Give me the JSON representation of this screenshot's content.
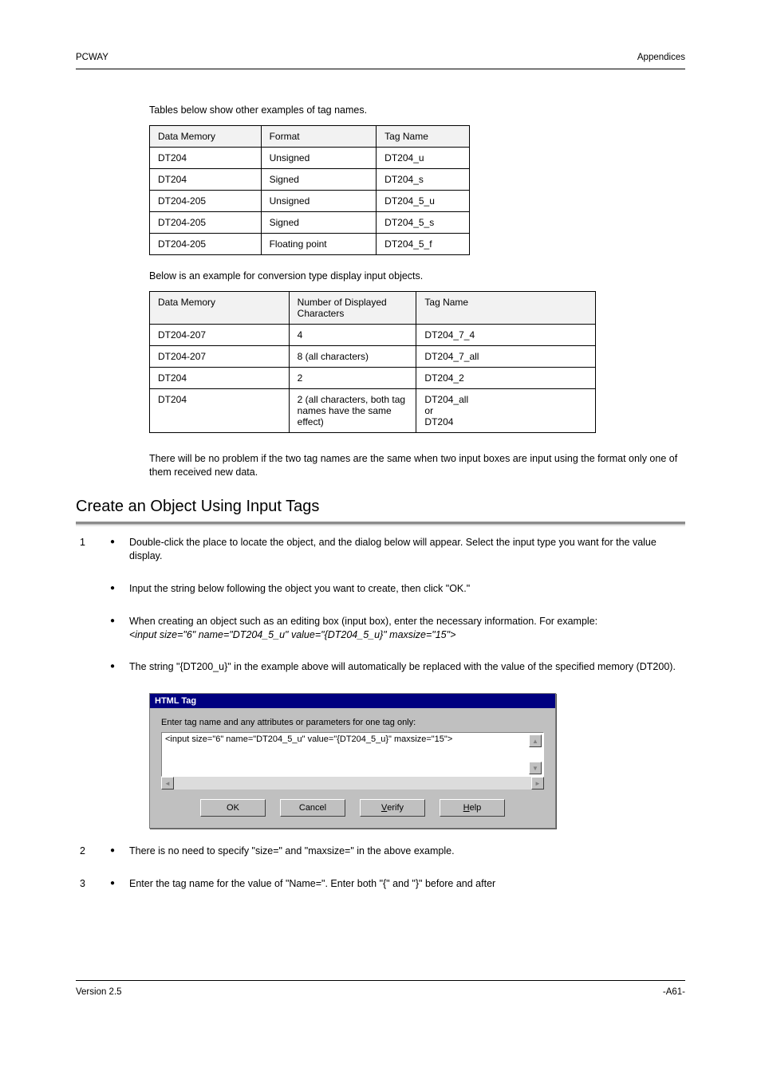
{
  "header": {
    "left": "PCWAY",
    "right": "Appendices"
  },
  "intro": "Tables below show other examples of tag names.",
  "table1": {
    "headers": [
      "Data Memory",
      "Format",
      "Tag Name"
    ],
    "rows": [
      [
        "DT204",
        "Unsigned",
        "DT204_u"
      ],
      [
        "DT204",
        "Signed",
        "DT204_s"
      ],
      [
        "DT204-205",
        "Unsigned",
        "DT204_5_u"
      ],
      [
        "DT204-205",
        "Signed",
        "DT204_5_s"
      ],
      [
        "DT204-205",
        "Floating point",
        "DT204_5_f"
      ]
    ]
  },
  "between": "Below is an example for conversion type display input objects.",
  "table2": {
    "headers": [
      "Data Memory",
      "Number of Displayed Characters",
      "Tag Name"
    ],
    "rows": [
      [
        "DT204-207",
        "4",
        "DT204_7_4"
      ],
      [
        "DT204-207",
        "8 (all characters)",
        "DT204_7_all"
      ],
      [
        "DT204",
        "2",
        "DT204_2"
      ],
      [
        "DT204",
        "2 (all characters, both tag names have the same effect)",
        "DT204_all\nor\nDT204"
      ]
    ]
  },
  "after": "There will be no problem if the two tag names are the same when two input boxes are input using the format only one of them received new data.",
  "heading": "Create an Object Using Input Tags",
  "steps": [
    {
      "num": "1",
      "text": "Double-click the place to locate the object, and the dialog below will appear. Select the input type you want for the value display."
    },
    {
      "num": "",
      "text": "Input the string below following the object you want to create, then click \"OK.\""
    },
    {
      "num": "",
      "text": "When creating an object such as an editing box (input box), enter the necessary information. For example:\n<input size=\"6\" name=\"DT204_5_u\" value=\"{DT204_5_u}\" maxsize=\"15\">"
    },
    {
      "num": "",
      "text": "The string \"{DT200_u}\" in the example above will automatically be replaced with the value of the specified memory (DT200)."
    },
    {
      "num": "2  •",
      "text": "There is no need to specify \"size=\" and \"maxsize=\" in the above example."
    },
    {
      "num": "3  •",
      "text": "Enter the tag name for the value of \"Name=\". Enter both \"{\" and \"}\" before and after"
    }
  ],
  "dialog": {
    "title": "HTML Tag",
    "label": "Enter tag name and any attributes or parameters for one tag only:",
    "value": "<input size=\"6\" name=\"DT204_5_u\" value=\"{DT204_5_u}\" maxsize=\"15\">",
    "buttons": {
      "ok": "OK",
      "cancel": "Cancel",
      "verify": "Verify",
      "help": "Help"
    }
  },
  "footer": {
    "left": "Version 2.5",
    "right": "-A61-"
  }
}
